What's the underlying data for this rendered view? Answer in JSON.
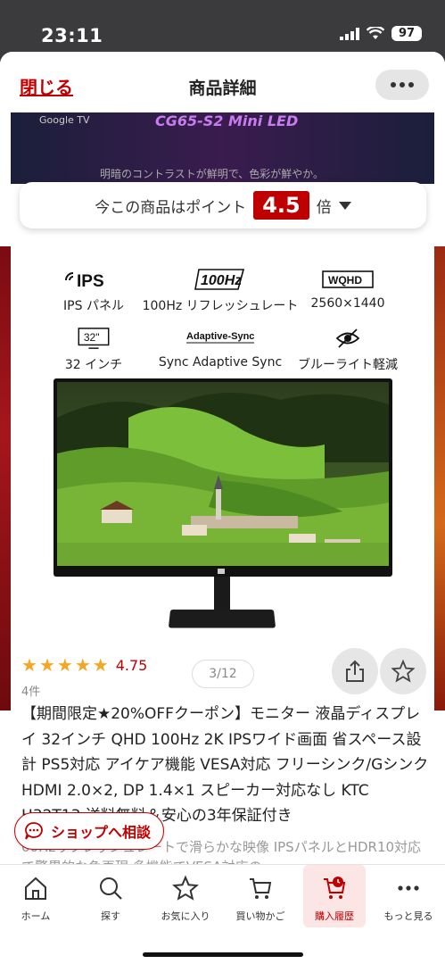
{
  "status_bar": {
    "time": "23:11",
    "battery": "97"
  },
  "header": {
    "close_label": "閉じる",
    "title": "商品詳細"
  },
  "banner": {
    "left_text": "Google TV",
    "right_text": "CG65-S2 Mini LED",
    "bottom_text": "明暗のコントラストが鮮明で、色彩が鮮やか。"
  },
  "points": {
    "prefix": "今この商品はポイント",
    "value": "4.5",
    "suffix": "倍"
  },
  "features": {
    "ips": {
      "icon_text": "IPS",
      "label": "IPS パネル"
    },
    "hz": {
      "icon_text": "100Hz",
      "label": "100Hz リフレッシュレート"
    },
    "res": {
      "icon_text": "WQHD",
      "label": "2560×1440"
    },
    "size": {
      "icon_text": "32\"",
      "label": "32 インチ"
    },
    "sync": {
      "icon_text": "Adaptive-Sync",
      "label": "Sync Adaptive Sync"
    },
    "blue": {
      "label": "ブルーライト軽減"
    }
  },
  "gallery": {
    "counter": "3/12"
  },
  "rating": {
    "value": "4.75",
    "count": "4件",
    "stars": 5
  },
  "product": {
    "title": "【期間限定★20%OFFクーポン】モニター 液晶ディスプレイ 32インチ QHD 100Hz 2K IPSワイド画面 省スペース設計 PS5対応 アイケア機能 VESA対応 フリーシンク/Gシンク HDMI 2.0×2, DP 1.4×1 スピーカー対応なし KTC H32T13 送料無料＆安心の3年保証付き",
    "description": "00Hzリフレッシュレートで滑らかな映像 IPSパネルとHDR10対応で驚異的な色再現 多機能でVESA対応の"
  },
  "shop_button": {
    "label": "ショップへ相談"
  },
  "nav": {
    "home": "ホーム",
    "search": "探す",
    "favorites": "お気に入り",
    "cart": "買い物かご",
    "history": "購入履歴",
    "more": "もっと見る"
  },
  "colors": {
    "accent": "#bf0000",
    "star": "#f5a623"
  }
}
